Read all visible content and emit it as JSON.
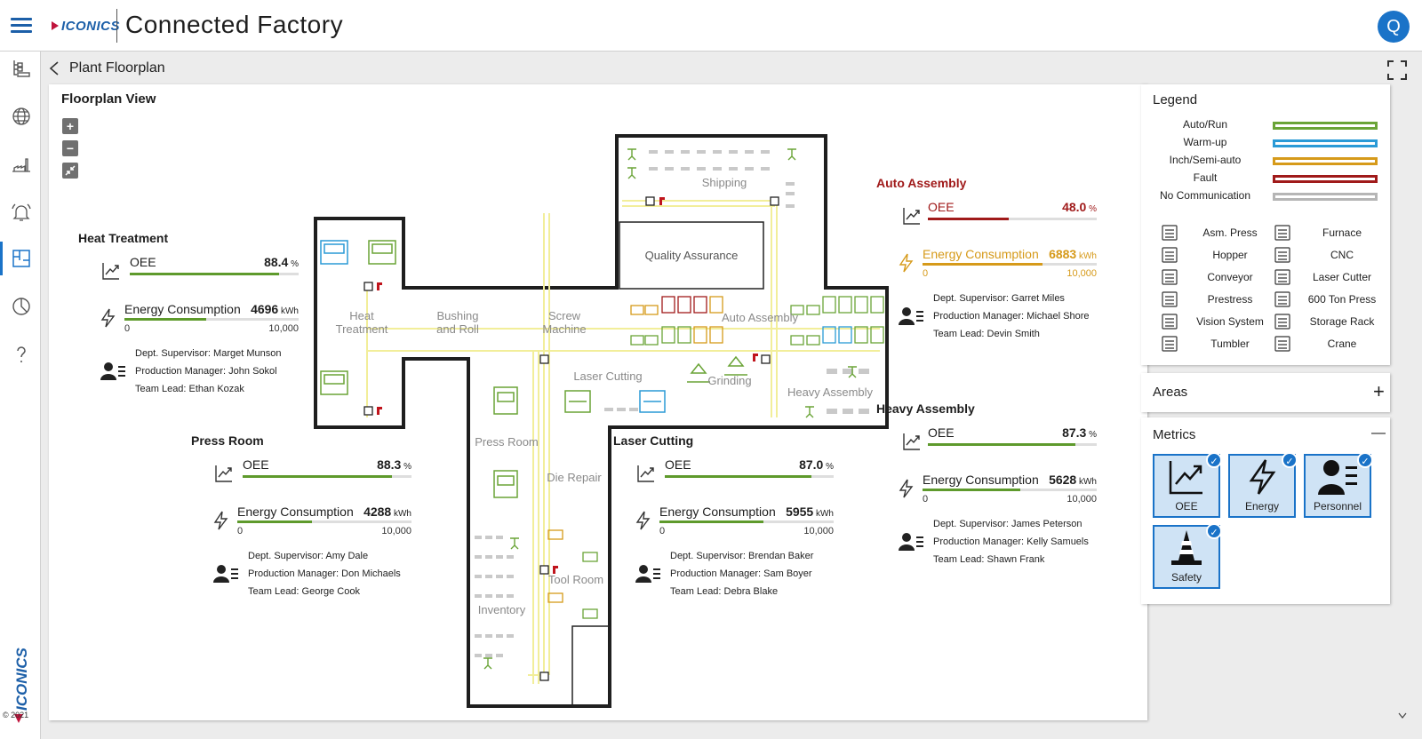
{
  "app": {
    "brand": "ICONICS",
    "title": "Connected Factory",
    "search_glyph": "Q",
    "copyright": "© 2021"
  },
  "breadcrumb": {
    "label": "Plant Floorplan"
  },
  "floorplan": {
    "title": "Floorplan View",
    "areas": {
      "shipping": "Shipping",
      "qa": "Quality Assurance",
      "heat": "Heat\nTreatment",
      "bushing": "Bushing\nand Roll",
      "screw": "Screw\nMachine",
      "auto": "Auto Assembly",
      "laser": "Laser Cutting",
      "grinding": "Grinding",
      "heavy": "Heavy Assembly",
      "press": "Press Room",
      "die": "Die Repair",
      "tool": "Tool Room",
      "inventory": "Inventory"
    }
  },
  "kpis": [
    {
      "name": "Heat Treatment",
      "oee": "88.4",
      "oee_pct": 88.4,
      "energy": "4696",
      "energy_frac": 0.4696,
      "color": "#5e9a2c",
      "name_color": "#1e1e1e",
      "ppl": [
        "Dept. Supervisor: Marget Munson",
        "Production Manager: John Sokol",
        "Team Lead: Ethan Kozak"
      ]
    },
    {
      "name": "Press Room",
      "oee": "88.3",
      "oee_pct": 88.3,
      "energy": "4288",
      "energy_frac": 0.4288,
      "color": "#5e9a2c",
      "name_color": "#1e1e1e",
      "ppl": [
        "Dept. Supervisor: Amy Dale",
        "Production Manager: Don Michaels",
        "Team Lead: George Cook"
      ]
    },
    {
      "name": "Laser Cutting",
      "oee": "87.0",
      "oee_pct": 87.0,
      "energy": "5955",
      "energy_frac": 0.5955,
      "color": "#5e9a2c",
      "name_color": "#1e1e1e",
      "ppl": [
        "Dept. Supervisor: Brendan Baker",
        "Production Manager: Sam Boyer",
        "Team Lead: Debra Blake"
      ]
    },
    {
      "name": "Auto Assembly",
      "oee": "48.0",
      "oee_pct": 48.0,
      "energy": "6883",
      "energy_frac": 0.6883,
      "color": "#a01a1a",
      "ecolor": "#d69a1a",
      "name_color": "#a01a1a",
      "ppl": [
        "Dept. Supervisor: Garret Miles",
        "Production Manager: Michael Shore",
        "Team Lead: Devin Smith"
      ]
    },
    {
      "name": "Heavy Assembly",
      "oee": "87.3",
      "oee_pct": 87.3,
      "energy": "5628",
      "energy_frac": 0.5628,
      "color": "#5e9a2c",
      "name_color": "#1e1e1e",
      "ppl": [
        "Dept. Supervisor: James Peterson",
        "Production Manager: Kelly Samuels",
        "Team Lead: Shawn Frank"
      ]
    }
  ],
  "kpi_labels": {
    "oee": "OEE",
    "energy": "Energy Consumption",
    "unit_pct": "%",
    "unit_kwh": "kWh",
    "min": "0",
    "max": "10,000"
  },
  "legend": {
    "title": "Legend",
    "states": [
      {
        "label": "Auto/Run",
        "color": "#6aa437"
      },
      {
        "label": "Warm-up",
        "color": "#2a9ad6"
      },
      {
        "label": "Inch/Semi-auto",
        "color": "#d69a1a"
      },
      {
        "label": "Fault",
        "color": "#a01a1a"
      },
      {
        "label": "No Communication",
        "color": "#b5b5b5"
      }
    ],
    "equipment_left": [
      "Asm. Press",
      "Hopper",
      "Conveyor",
      "Prestress",
      "Vision System",
      "Tumbler"
    ],
    "equipment_right": [
      "Furnace",
      "CNC",
      "Laser Cutter",
      "600 Ton Press",
      "Storage Rack",
      "Crane"
    ]
  },
  "areas_panel": {
    "title": "Areas",
    "action": "+"
  },
  "metrics_panel": {
    "title": "Metrics",
    "action": "—",
    "tiles": [
      "OEE",
      "Energy",
      "Personnel",
      "Safety"
    ]
  },
  "colors": {
    "accent": "#1a73c8",
    "run": "#6aa437",
    "warm": "#2a9ad6",
    "semi": "#d69a1a",
    "fault": "#a01a1a",
    "nocomm": "#b5b5b5",
    "path": "#f2ee9a"
  }
}
